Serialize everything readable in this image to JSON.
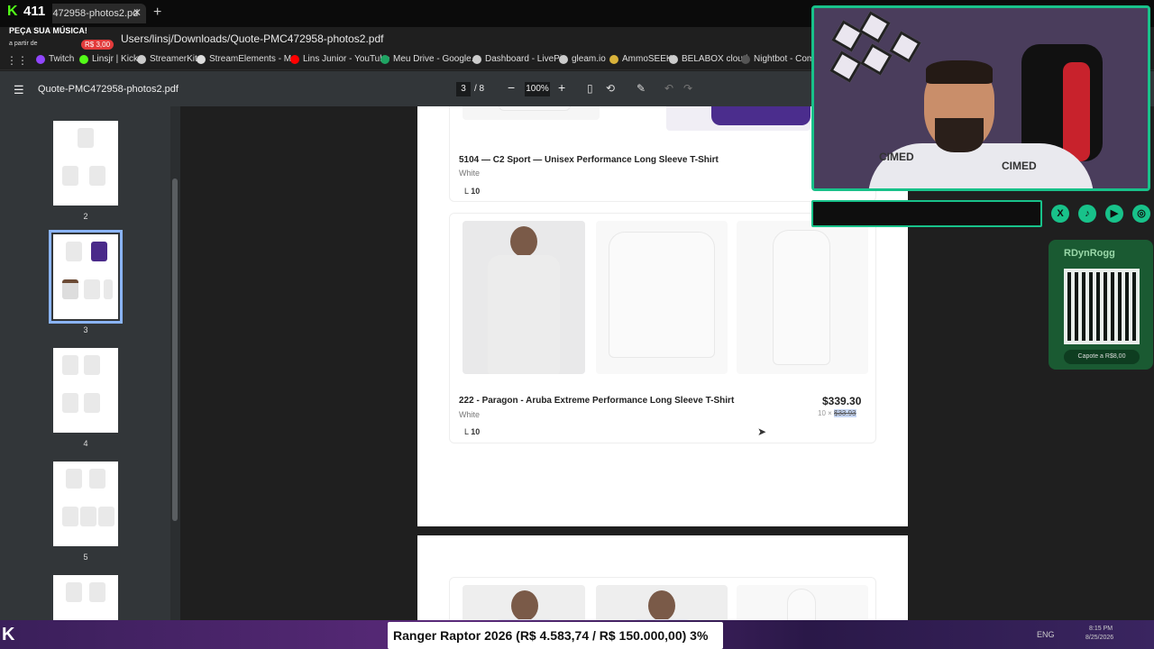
{
  "browser": {
    "tab_title": "PMC472958-photos2.pd",
    "url": "Users/linsj/Downloads/Quote-PMC472958-photos2.pdf",
    "bookmarks": [
      "Twitch",
      "Linsjr | Kick",
      "StreamerKit",
      "StreamElements - M...",
      "Lins Junior - YouTube",
      "Meu Drive - Google...",
      "Dashboard - LivePix",
      "gleam.io",
      "AmmoSEEK",
      "BELABOX cloud",
      "Nightbot - Comm"
    ]
  },
  "overlay": {
    "kick_count": "411",
    "song_title": "PEÇA SUA MÚSICA!",
    "song_sub": "a partir de",
    "song_price": "R$ 3,00",
    "cam_logo": "CIMED",
    "qr_title": "RDynRogg",
    "qr_footer": "Capote a R$8,00",
    "ticker": "Ranger Raptor 2026 (R$ 4.583,74 / R$ 150.000,00)   3%",
    "tray_lang": "ENG",
    "tray_time": "8:15 PM",
    "tray_date": "8/25/2026"
  },
  "pdf": {
    "file_name": "Quote-PMC472958-photos2.pdf",
    "current_page": "3",
    "total_pages": "/ 8",
    "zoom": "100%",
    "thumbnails": [
      {
        "label": "2"
      },
      {
        "label": "3"
      },
      {
        "label": "4"
      },
      {
        "label": "5"
      }
    ]
  },
  "products": [
    {
      "title": "5104 — C2 Sport — Unisex Performance Long Sleeve T-Shirt",
      "color": "White",
      "size": "L",
      "qty": "10"
    },
    {
      "title": "222 - Paragon - Aruba Extreme Performance Long Sleeve T-Shirt",
      "color": "White",
      "size": "L",
      "qty": "10",
      "price": "$339.30",
      "unit_qty": "10 ×",
      "unit_price": "$33.93"
    }
  ],
  "colors": {
    "accent": "#18c28a",
    "kick_green": "#53fc18",
    "selection": "#8ab4f8"
  }
}
